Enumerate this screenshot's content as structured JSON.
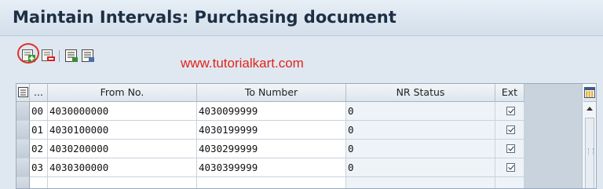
{
  "window": {
    "title": "Maintain Intervals: Purchasing document"
  },
  "toolbar": {
    "watermark": "www.tutorialkart.com",
    "buttons": [
      {
        "icon": "insert-interval-icon"
      },
      {
        "icon": "delete-interval-icon"
      },
      {
        "icon": "change-status-icon"
      },
      {
        "icon": "display-icon"
      }
    ]
  },
  "table": {
    "columns": {
      "selector_icon": "table-settings-icon",
      "no": "...",
      "from": "From No.",
      "to": "To Number",
      "status": "NR Status",
      "ext": "Ext"
    },
    "rows": [
      {
        "no": "00",
        "from": "4030000000",
        "to": "4030099999",
        "status": "0",
        "ext": true
      },
      {
        "no": "01",
        "from": "4030100000",
        "to": "4030199999",
        "status": "0",
        "ext": true
      },
      {
        "no": "02",
        "from": "4030200000",
        "to": "4030299999",
        "status": "0",
        "ext": true
      },
      {
        "no": "03",
        "from": "4030300000",
        "to": "4030399999",
        "status": "0",
        "ext": true
      }
    ]
  },
  "colors": {
    "highlight": "#e0302b",
    "watermark": "#e2231a"
  }
}
